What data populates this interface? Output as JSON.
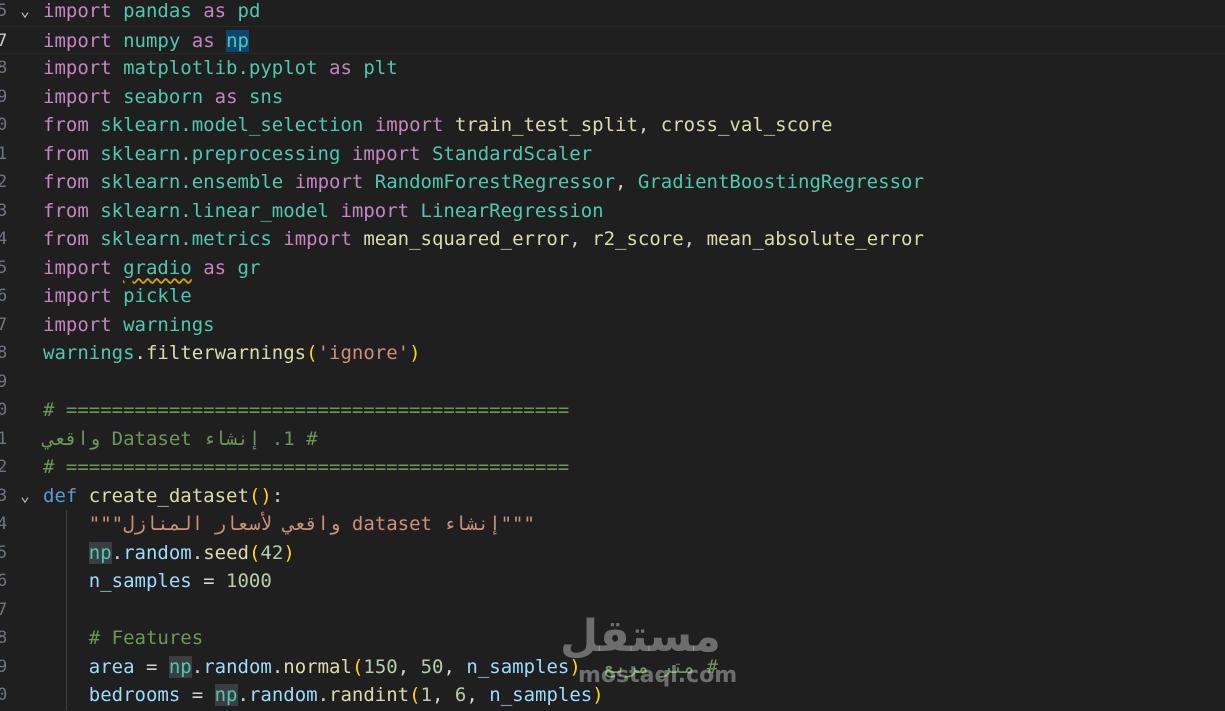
{
  "editor": {
    "lines": [
      {
        "num": "5",
        "fold": "⌄",
        "segs": [
          [
            "kw",
            "import"
          ],
          [
            "p",
            " "
          ],
          [
            "mod",
            "pandas"
          ],
          [
            "p",
            " "
          ],
          [
            "kw",
            "as"
          ],
          [
            "p",
            " "
          ],
          [
            "mod",
            "pd"
          ]
        ]
      },
      {
        "num": "7",
        "current": true,
        "segs": [
          [
            "kw",
            "import"
          ],
          [
            "p",
            " "
          ],
          [
            "mod",
            "numpy"
          ],
          [
            "p",
            " "
          ],
          [
            "kw",
            "as"
          ],
          [
            "p",
            " "
          ],
          [
            "mod hl",
            "np"
          ]
        ]
      },
      {
        "num": "8",
        "segs": [
          [
            "kw",
            "import"
          ],
          [
            "p",
            " "
          ],
          [
            "mod",
            "matplotlib.pyplot"
          ],
          [
            "p",
            " "
          ],
          [
            "kw",
            "as"
          ],
          [
            "p",
            " "
          ],
          [
            "mod",
            "plt"
          ]
        ]
      },
      {
        "num": "9",
        "segs": [
          [
            "kw",
            "import"
          ],
          [
            "p",
            " "
          ],
          [
            "mod",
            "seaborn"
          ],
          [
            "p",
            " "
          ],
          [
            "kw",
            "as"
          ],
          [
            "p",
            " "
          ],
          [
            "mod",
            "sns"
          ]
        ]
      },
      {
        "num": "0",
        "segs": [
          [
            "kw",
            "from"
          ],
          [
            "p",
            " "
          ],
          [
            "mod",
            "sklearn.model_selection"
          ],
          [
            "p",
            " "
          ],
          [
            "kw",
            "import"
          ],
          [
            "p",
            " "
          ],
          [
            "fn",
            "train_test_split"
          ],
          [
            "p",
            ", "
          ],
          [
            "fn",
            "cross_val_score"
          ]
        ]
      },
      {
        "num": "1",
        "segs": [
          [
            "kw",
            "from"
          ],
          [
            "p",
            " "
          ],
          [
            "mod",
            "sklearn.preprocessing"
          ],
          [
            "p",
            " "
          ],
          [
            "kw",
            "import"
          ],
          [
            "p",
            " "
          ],
          [
            "mod",
            "StandardScaler"
          ]
        ]
      },
      {
        "num": "2",
        "segs": [
          [
            "kw",
            "from"
          ],
          [
            "p",
            " "
          ],
          [
            "mod",
            "sklearn.ensemble"
          ],
          [
            "p",
            " "
          ],
          [
            "kw",
            "import"
          ],
          [
            "p",
            " "
          ],
          [
            "mod",
            "RandomForestRegressor"
          ],
          [
            "p",
            ", "
          ],
          [
            "mod",
            "GradientBoostingRegressor"
          ]
        ]
      },
      {
        "num": "3",
        "segs": [
          [
            "kw",
            "from"
          ],
          [
            "p",
            " "
          ],
          [
            "mod",
            "sklearn.linear_model"
          ],
          [
            "p",
            " "
          ],
          [
            "kw",
            "import"
          ],
          [
            "p",
            " "
          ],
          [
            "mod",
            "LinearRegression"
          ]
        ]
      },
      {
        "num": "4",
        "segs": [
          [
            "kw",
            "from"
          ],
          [
            "p",
            " "
          ],
          [
            "mod",
            "sklearn.metrics"
          ],
          [
            "p",
            " "
          ],
          [
            "kw",
            "import"
          ],
          [
            "p",
            " "
          ],
          [
            "fn",
            "mean_squared_error"
          ],
          [
            "p",
            ", "
          ],
          [
            "fn",
            "r2_score"
          ],
          [
            "p",
            ", "
          ],
          [
            "fn",
            "mean_absolute_error"
          ]
        ]
      },
      {
        "num": "5",
        "segs": [
          [
            "kw",
            "import"
          ],
          [
            "p",
            " "
          ],
          [
            "mod squiggle",
            "gradio"
          ],
          [
            "p",
            " "
          ],
          [
            "kw",
            "as"
          ],
          [
            "p",
            " "
          ],
          [
            "mod",
            "gr"
          ]
        ]
      },
      {
        "num": "6",
        "segs": [
          [
            "kw",
            "import"
          ],
          [
            "p",
            " "
          ],
          [
            "mod",
            "pickle"
          ]
        ]
      },
      {
        "num": "7",
        "segs": [
          [
            "kw",
            "import"
          ],
          [
            "p",
            " "
          ],
          [
            "mod",
            "warnings"
          ]
        ]
      },
      {
        "num": "8",
        "segs": [
          [
            "mod",
            "warnings"
          ],
          [
            "p",
            "."
          ],
          [
            "fn",
            "filterwarnings"
          ],
          [
            "br",
            "("
          ],
          [
            "str",
            "'ignore'"
          ],
          [
            "br",
            ")"
          ]
        ]
      },
      {
        "num": "9",
        "segs": []
      },
      {
        "num": "0",
        "segs": [
          [
            "com",
            "# ============================================"
          ]
        ]
      },
      {
        "num": "1",
        "segs": [
          [
            "com",
            "# 1. إنشاء Dataset واقعي"
          ]
        ]
      },
      {
        "num": "2",
        "segs": [
          [
            "com",
            "# ============================================"
          ]
        ]
      },
      {
        "num": "3",
        "fold": "⌄",
        "segs": [
          [
            "kw2",
            "def"
          ],
          [
            "p",
            " "
          ],
          [
            "fn",
            "create_dataset"
          ],
          [
            "br",
            "()"
          ],
          [
            "p",
            ":"
          ]
        ]
      },
      {
        "num": "4",
        "indent": true,
        "segs": [
          [
            "p",
            "    "
          ],
          [
            "str",
            "\"\"\"إنشاء dataset واقعي لأسعار المنازل\"\"\""
          ]
        ]
      },
      {
        "num": "5",
        "indent": true,
        "segs": [
          [
            "p",
            "    "
          ],
          [
            "mod hl2",
            "np"
          ],
          [
            "p",
            "."
          ],
          [
            "var",
            "random"
          ],
          [
            "p",
            "."
          ],
          [
            "fn",
            "seed"
          ],
          [
            "br",
            "("
          ],
          [
            "num",
            "42"
          ],
          [
            "br",
            ")"
          ]
        ]
      },
      {
        "num": "6",
        "indent": true,
        "segs": [
          [
            "p",
            "    "
          ],
          [
            "var",
            "n_samples"
          ],
          [
            "p",
            " = "
          ],
          [
            "num",
            "1000"
          ]
        ]
      },
      {
        "num": "7",
        "indent": true,
        "segs": []
      },
      {
        "num": "8",
        "indent": true,
        "segs": [
          [
            "p",
            "    "
          ],
          [
            "com",
            "# Features"
          ]
        ]
      },
      {
        "num": "9",
        "indent": true,
        "segs": [
          [
            "p",
            "    "
          ],
          [
            "var",
            "area"
          ],
          [
            "p",
            " = "
          ],
          [
            "mod hl2",
            "np"
          ],
          [
            "p",
            "."
          ],
          [
            "var",
            "random"
          ],
          [
            "p",
            "."
          ],
          [
            "fn",
            "normal"
          ],
          [
            "br",
            "("
          ],
          [
            "num",
            "150"
          ],
          [
            "p",
            ", "
          ],
          [
            "num",
            "50"
          ],
          [
            "p",
            ", "
          ],
          [
            "var",
            "n_samples"
          ],
          [
            "br",
            ")"
          ],
          [
            "p",
            "  "
          ],
          [
            "com",
            "# متر مربع"
          ]
        ]
      },
      {
        "num": "0",
        "indent": true,
        "segs": [
          [
            "p",
            "    "
          ],
          [
            "var",
            "bedrooms"
          ],
          [
            "p",
            " = "
          ],
          [
            "mod hl2",
            "np"
          ],
          [
            "p",
            "."
          ],
          [
            "var",
            "random"
          ],
          [
            "p",
            "."
          ],
          [
            "fn",
            "randint"
          ],
          [
            "br",
            "("
          ],
          [
            "num",
            "1"
          ],
          [
            "p",
            ", "
          ],
          [
            "num",
            "6"
          ],
          [
            "p",
            ", "
          ],
          [
            "var",
            "n_samples"
          ],
          [
            "br",
            ")"
          ]
        ]
      }
    ]
  },
  "watermark": {
    "arabic": "مستقل",
    "latin": "mostaql.com"
  }
}
